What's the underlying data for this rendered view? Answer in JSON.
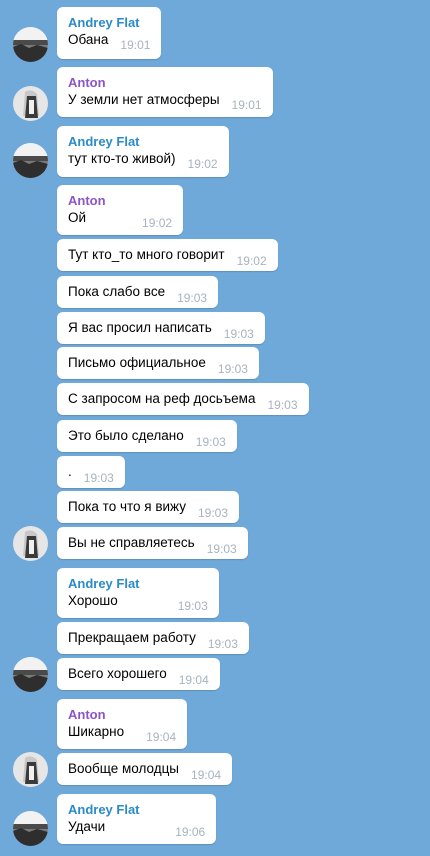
{
  "colors": {
    "background": "#6fa9d9",
    "bubble": "#ffffff",
    "andrey_name": "#2a8bc7",
    "anton_name": "#8d56c4",
    "timestamp": "#a7b3bf"
  },
  "messages": [
    {
      "sender": "Andrey Flat",
      "text": "Обана",
      "time": "19:01"
    },
    {
      "sender": "Anton",
      "text": "У земли нет атмосферы",
      "time": "19:01"
    },
    {
      "sender": "Andrey Flat",
      "text": "тут кто-то живой)",
      "time": "19:02"
    },
    {
      "sender": "Anton",
      "text": "Ой",
      "time": "19:02"
    },
    {
      "text": "Тут кто_то много говорит",
      "time": "19:02"
    },
    {
      "text": "Пока слабо все",
      "time": "19:03"
    },
    {
      "text": "Я вас просил написать",
      "time": "19:03"
    },
    {
      "text": "Письмо официальное",
      "time": "19:03"
    },
    {
      "text": "С запросом на реф досьъема",
      "time": "19:03"
    },
    {
      "text": "Это было сделано",
      "time": "19:03"
    },
    {
      "text": ".",
      "time": "19:03"
    },
    {
      "text": "Пока то что я вижу",
      "time": "19:03"
    },
    {
      "text": "Вы не справляетесь",
      "time": "19:03"
    },
    {
      "sender": "Andrey Flat",
      "text": "Хорошо",
      "time": "19:03"
    },
    {
      "text": "Прекращаем работу",
      "time": "19:03"
    },
    {
      "text": "Всего хорошего",
      "time": "19:04"
    },
    {
      "sender": "Anton",
      "text": "Шикарно",
      "time": "19:04"
    },
    {
      "text": "Вообще молодцы",
      "time": "19:04"
    },
    {
      "sender": "Andrey Flat",
      "text": "Удачи",
      "time": "19:06"
    }
  ]
}
